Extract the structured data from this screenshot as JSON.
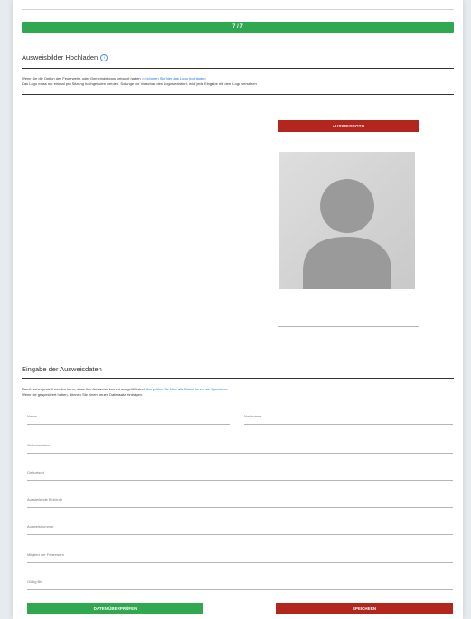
{
  "progress": {
    "label": "7 / 7",
    "value": 1.0
  },
  "upload_section": {
    "title": "Ausweisbilder Hochladen",
    "line1_text": "Wenn Sie die Option des Feuerwehr- oder Gemeindelogos gebucht haben",
    "line1_link": ">> können Sie hier das Logo hochladen.",
    "line2_text": "Das Logo muss nur einmal pro Sitzung hochgeladen werden. Solange die Vorschau des Logos existiert, wird jede Eingabe mit dem Logo versehen",
    "photo_button": "AUSWEISFOTO"
  },
  "data_section": {
    "title": "Eingabe der Ausweisdaten",
    "line1_text": "Damit sichergestellt werden kann, dass Ihre Ausweise korrekt ausgefüllt sind",
    "line1_link": "überprüfen Sie bitte alle Daten bevor sie Speichern.",
    "line2_text": "Wenn sie gespeichert haben, können Sie einen neuen Datensatz eintragen.",
    "fields": {
      "name": "Name",
      "nachname": "Nachname",
      "geburtsdatum": "Geburtsdatum",
      "geburtsort": "Geburtsort",
      "behoerde": "Ausstellende Behörde",
      "ausweisnummer": "Ausweisnummer",
      "mitglied": "Mitglied der Feuerwehr",
      "gueltig": "Gültig Bis"
    },
    "check_button": "DATEN ÜBERPRÜFEN",
    "save_button": "SPEICHERN"
  },
  "colors": {
    "green": "#2fa84f",
    "red": "#b3261e",
    "link": "#1a73e8"
  }
}
